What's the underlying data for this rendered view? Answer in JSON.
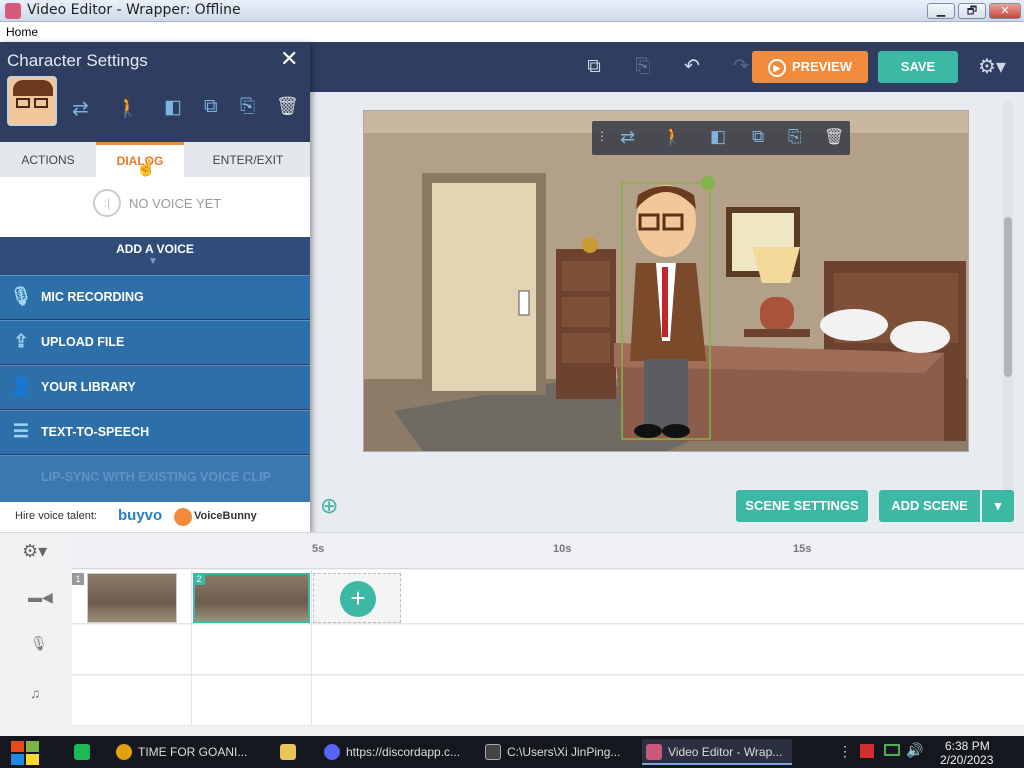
{
  "window": {
    "title": "Video Editor - Wrapper: Offline",
    "minimize": "▁",
    "maximize": "🗗",
    "close": "✕"
  },
  "menu": {
    "home": "Home"
  },
  "toolbar": {
    "preview_label": "PREVIEW",
    "save_label": "SAVE",
    "icons": [
      "copy-icon",
      "paste-icon",
      "undo-icon",
      "redo-icon",
      "settings-gear-icon"
    ]
  },
  "panel": {
    "title": "Character Settings",
    "tabs": [
      "ACTIONS",
      "DIALOG",
      "ENTER/EXIT"
    ],
    "active_tab": "DIALOG",
    "no_voice": "NO VOICE YET",
    "add_voice": "ADD A VOICE",
    "options": [
      {
        "label": "MIC RECORDING",
        "icon": "microphone-icon"
      },
      {
        "label": "UPLOAD FILE",
        "icon": "upload-icon"
      },
      {
        "label": "YOUR LIBRARY",
        "icon": "library-person-icon"
      },
      {
        "label": "TEXT-TO-SPEECH",
        "icon": "text-to-speech-icon"
      },
      {
        "label": "LIP-SYNC WITH EXISTING VOICE CLIP",
        "icon": "",
        "disabled": true
      }
    ],
    "hire_label": "Hire voice talent:",
    "partner1": "buyvo",
    "partner2": "VoiceBunny"
  },
  "stage": {
    "scene_settings": "SCENE SETTINGS",
    "add_scene": "ADD SCENE"
  },
  "timeline": {
    "ruler": [
      "5s",
      "10s",
      "15s"
    ],
    "scenes": [
      "1",
      "2"
    ],
    "tracks": [
      "video-track-icon",
      "voice-track-icon",
      "music-track-icon"
    ]
  },
  "taskbar": {
    "items": [
      {
        "label": "TIME FOR GOANI...",
        "color": "#e0a010"
      },
      {
        "label": "",
        "color": "#e8c45a"
      },
      {
        "label": "https://discordapp.c...",
        "color": "#5865f2"
      },
      {
        "label": "C:\\Users\\Xi JinPing...",
        "color": "#444"
      },
      {
        "label": "Video Editor - Wrap...",
        "color": "#c9597a"
      }
    ],
    "time": "6:38 PM",
    "date": "2/20/2023"
  },
  "colors": {
    "accent_teal": "#3cb8a4",
    "accent_orange": "#f28c3c",
    "navy": "#2f3e60",
    "option_blue": "#2d6fa8"
  }
}
